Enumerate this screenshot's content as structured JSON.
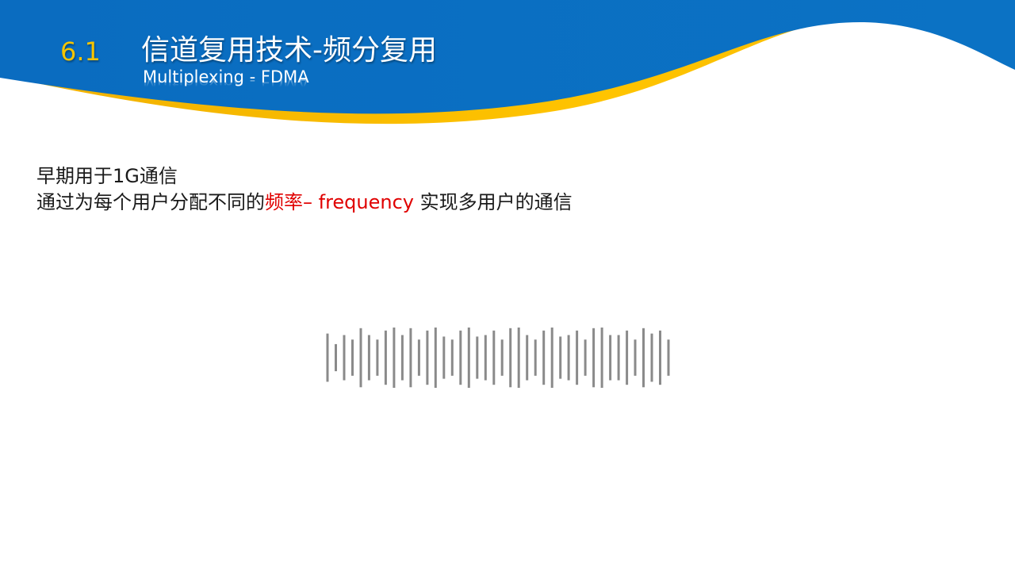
{
  "colors": {
    "header_blue": "#0a6cc0",
    "header_yellow": "#f5b800",
    "section_number": "#f5c400",
    "highlight_red": "#e00000",
    "waveform_gray": "#8a8a8a"
  },
  "header": {
    "section_number": "6.1",
    "title": "信道复用技术-频分复用",
    "subtitle": "Multiplexing - FDMA"
  },
  "content": {
    "line1": "早期用于1G通信",
    "line2_before": "通过为每个用户分配不同的",
    "line2_highlight": "频率",
    "line2_dash": "– frequency",
    "line2_after": "实现多用户的通信"
  },
  "waveform": {
    "icon": "audio-waveform-icon",
    "bar_levels": [
      0.8,
      0.45,
      0.75,
      0.6,
      0.98,
      0.75,
      0.6,
      0.9,
      1.0,
      0.75,
      0.98,
      0.6,
      0.9,
      1.0,
      0.7,
      0.6,
      0.9,
      1.0,
      0.7,
      0.75,
      0.9,
      0.6,
      0.98,
      1.0,
      0.75,
      0.6,
      0.9,
      1.0,
      0.7,
      0.75,
      0.9,
      0.6,
      0.98,
      1.0,
      0.75,
      0.75,
      0.9,
      0.6,
      0.98,
      0.8,
      0.9,
      0.6
    ]
  }
}
